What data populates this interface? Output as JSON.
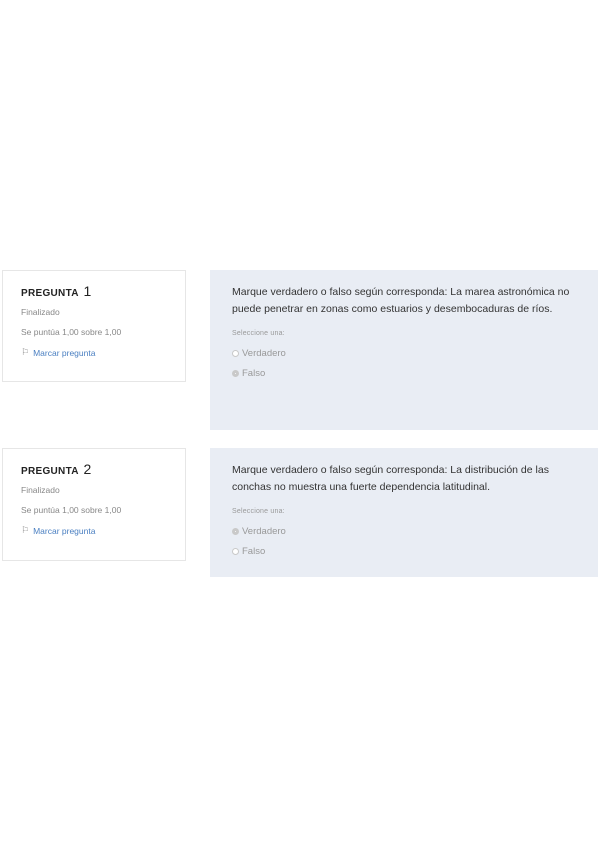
{
  "questions": [
    {
      "label": "PREGUNTA",
      "number": "1",
      "state": "Finalizado",
      "grade": "Se puntúa 1,00 sobre 1,00",
      "flag_label": "Marcar pregunta",
      "text": "Marque verdadero o falso según corresponda: La marea astronómica no puede penetrar en zonas como estuarios y desembocaduras de ríos.",
      "prompt": "Seleccione una:",
      "options": [
        {
          "label": "Verdadero",
          "selected": false
        },
        {
          "label": "Falso",
          "selected": true
        }
      ]
    },
    {
      "label": "PREGUNTA",
      "number": "2",
      "state": "Finalizado",
      "grade": "Se puntúa 1,00 sobre 1,00",
      "flag_label": "Marcar pregunta",
      "text": "Marque verdadero o falso según corresponda: La distribución de las conchas no muestra una fuerte dependencia latitudinal.",
      "prompt": "Seleccione una:",
      "options": [
        {
          "label": "Verdadero",
          "selected": true
        },
        {
          "label": "Falso",
          "selected": false
        }
      ]
    }
  ]
}
